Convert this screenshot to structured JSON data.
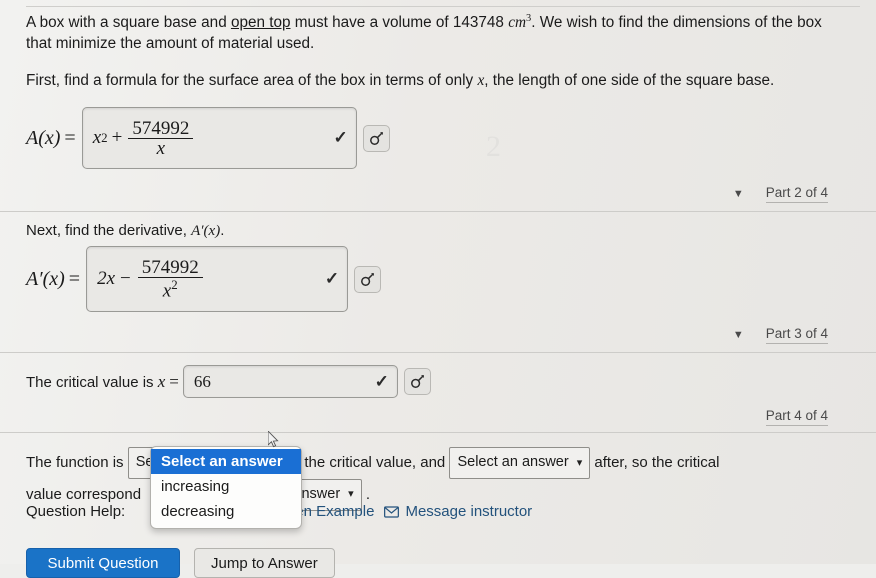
{
  "problem": {
    "line1_a": "A box with a square base and ",
    "line1_underlined": "open top",
    "line1_b": " must have a volume of 143748 ",
    "line1_units": "cm",
    "line1_exp": "3",
    "line1_c": ". We wish to find the dimensions of the box that minimize the amount of material used.",
    "line2_a": "First, find a formula for the surface area of the box in terms of only ",
    "line2_var": "x",
    "line2_b": ", the length of one side of the square base."
  },
  "watermark": "2",
  "part2": {
    "lhs_fn": "A",
    "lhs_arg": "(x)",
    "lhs_eq": "=",
    "answer_first_term": "x",
    "answer_first_exp": "2",
    "answer_operator": "+",
    "answer_frac_num": "574992",
    "answer_frac_den": "x",
    "correct_mark": "✓",
    "tool_icon": "preview-magnifier-icon",
    "part_label": "Part 2 of 4",
    "collapse_triangle": "▼"
  },
  "part3": {
    "intro_a": "Next, find the derivative, ",
    "intro_fn": "A′(x)",
    "intro_b": ".",
    "lhs_fn": "A′",
    "lhs_arg": "(x)",
    "lhs_eq": "=",
    "answer_first_term": "2x",
    "answer_operator": "−",
    "answer_frac_num": "574992",
    "answer_frac_den": "x",
    "answer_frac_den_exp": "2",
    "correct_mark": "✓",
    "tool_icon": "preview-magnifier-icon",
    "part_label": "Part 3 of 4",
    "collapse_triangle": "▼"
  },
  "part4": {
    "critical_text_a": "The critical value is ",
    "critical_var": "x",
    "critical_eq": "=",
    "critical_value": "66",
    "correct_mark": "✓",
    "tool_icon": "preview-magnifier-icon",
    "part_label": "Part 4 of 4"
  },
  "conclusion": {
    "text_a": "The function is",
    "select1_value": "Select an answer",
    "text_b": "until the critical value, and",
    "select2_value": "Select an answer",
    "text_c": "after, so the critical",
    "text_d": "value correspond",
    "select3_value": "an answer",
    "text_e": "."
  },
  "dropdown": {
    "open": true,
    "options": [
      "Select an answer",
      "increasing",
      "decreasing"
    ],
    "selected_index": 0,
    "highlight_color": "#1a6fd4"
  },
  "help": {
    "label": "Question Help:",
    "link_partial": "en Example",
    "message_icon": "envelope-icon",
    "message_label": "Message instructor",
    "link_color": "#23527c"
  },
  "buttons": {
    "submit": "Submit Question",
    "jump": "Jump to Answer",
    "submit_color": "#1a73c7"
  }
}
